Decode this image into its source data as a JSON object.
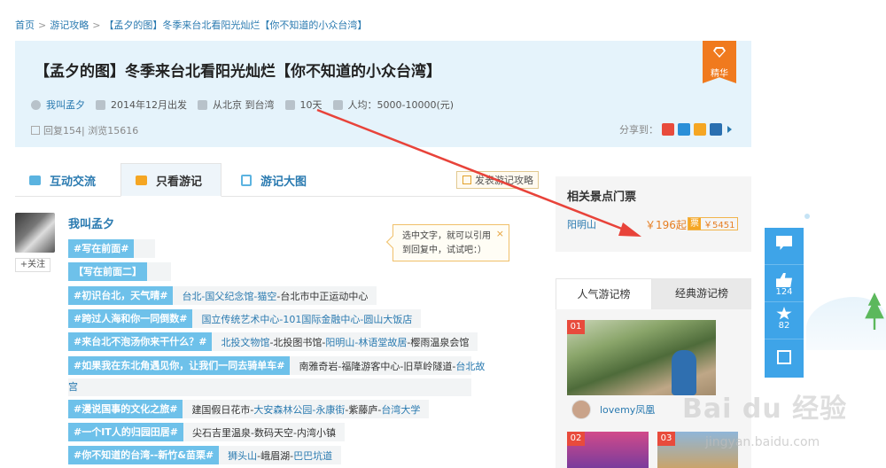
{
  "breadcrumb": {
    "items": [
      "首页",
      "游记攻略",
      "【孟夕的图】冬季来台北看阳光灿烂【你不知道的小众台湾】"
    ],
    "sep": ">"
  },
  "header": {
    "title": "【孟夕的图】冬季来台北看阳光灿烂【你不知道的小众台湾】",
    "author": "我叫孟夕",
    "date": "2014年12月出发",
    "route": "从北京 到台湾",
    "days": "10天",
    "budget": "人均：5000-10000(元)",
    "stats": "回复154| 浏览15616",
    "share_label": "分享到：",
    "badge": "精华",
    "share_colors": [
      "#e84b3c",
      "#2a8fd8",
      "#f5a623",
      "#2a6fb0"
    ]
  },
  "tabs": [
    {
      "label": "互动交流"
    },
    {
      "label": "只看游记"
    },
    {
      "label": "游记大图"
    }
  ],
  "post_button": "发表游记攻略",
  "post": {
    "username": "我叫孟夕",
    "follow": "+关注",
    "tags": [
      {
        "tag": "#写在前面#",
        "desc": []
      },
      {
        "tag": "【写在前面二】",
        "desc": []
      },
      {
        "tag": "#初识台北，天气晴#",
        "desc": [
          {
            "t": "台北-国父纪念馆-猫空",
            "link": true
          },
          {
            "t": "-台北市中正运动中心",
            "link": false
          }
        ]
      },
      {
        "tag": "#跨过人海和你一同倒数#",
        "desc": [
          {
            "t": "国立传统艺术中心-101国际金融中心-圆山大饭店",
            "link": true
          }
        ]
      },
      {
        "tag": "#来台北不泡汤你来干什么？#",
        "desc": [
          {
            "t": "北投文物馆",
            "link": true
          },
          {
            "t": "-北投图书馆-",
            "link": false
          },
          {
            "t": "阳明山-林语堂故居",
            "link": true
          },
          {
            "t": "-樱雨温泉会馆",
            "link": false
          }
        ]
      },
      {
        "tag": "#如果我在东北角遇见你，让我们一同去骑单车#",
        "desc": [
          {
            "t": "南雅奇岩-福隆游客中心-旧草岭隧道-",
            "link": false
          },
          {
            "t": "台北故",
            "link": true
          }
        ]
      },
      {
        "tag": "#漫说国事的文化之旅#",
        "desc": [
          {
            "t": "建国假日花市-",
            "link": false
          },
          {
            "t": "大安森林公园-永康街",
            "link": true
          },
          {
            "t": "-紫藤庐-",
            "link": false
          },
          {
            "t": "台湾大学",
            "link": true
          }
        ]
      },
      {
        "tag": "#一个IT人的归园田居#",
        "desc": [
          {
            "t": "尖石吉里温泉-数码天空-内湾小镇",
            "link": false
          }
        ]
      },
      {
        "tag": "#你不知道的台湾--新竹&苗栗#",
        "desc": [
          {
            "t": "狮头山",
            "link": true
          },
          {
            "t": "-峨眉湖-",
            "link": false
          },
          {
            "t": "巴巴坑道",
            "link": true
          }
        ]
      }
    ],
    "wrap_text": "宫"
  },
  "tooltip": {
    "line1": "选中文字，就可以引用",
    "line2": "到回复中，试试吧：）",
    "close": "×"
  },
  "tickets": {
    "heading": "相关景点门票",
    "spot": "阳明山",
    "price": "￥196起",
    "ticket_icon": "票",
    "price2": "￥5451"
  },
  "ranking": {
    "tab1": "人气游记榜",
    "tab2": "经典游记榜",
    "items": [
      {
        "num": "01",
        "user": "lovemy凤凰"
      },
      {
        "num": "02"
      },
      {
        "num": "03"
      }
    ]
  },
  "floating": {
    "like_count": "124",
    "fav_count": "82"
  },
  "watermark": {
    "main": "Bai du 经验",
    "sub": "jingyan.baidu.com"
  },
  "colors": {
    "accent": "#3ea4e8",
    "tag": "#6ec1ea",
    "badge": "#f07a1e",
    "arrow": "#e8433a"
  }
}
